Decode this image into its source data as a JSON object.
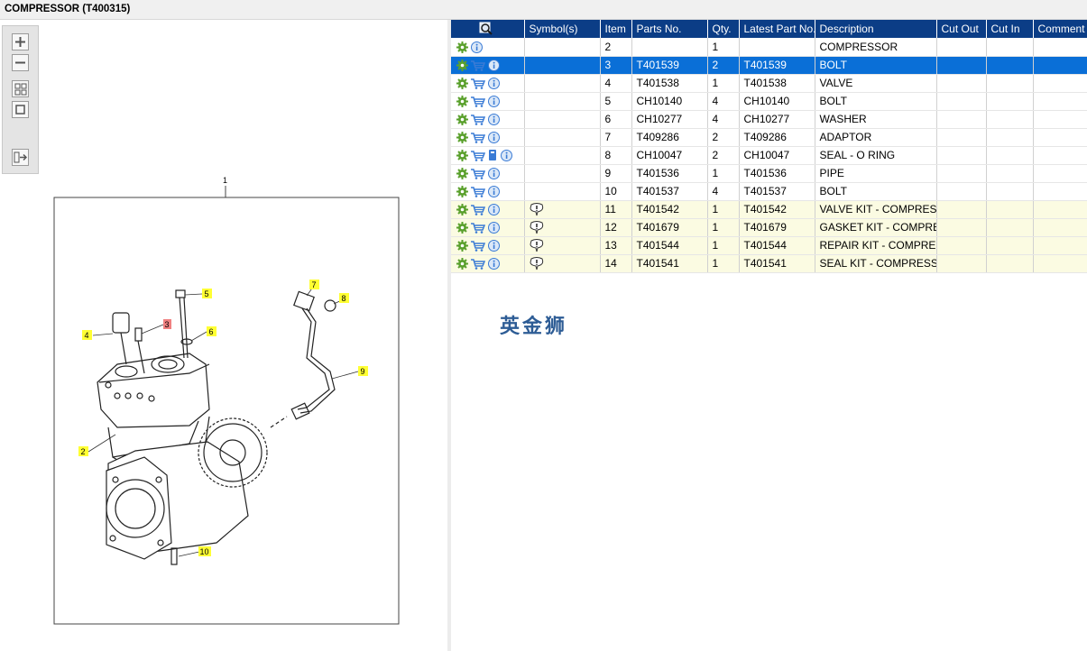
{
  "title": "COMPRESSOR (T400315)",
  "toolbar": {
    "buttons": [
      "zoom-in",
      "zoom-out",
      "fit-all",
      "fit-window",
      "export"
    ]
  },
  "diagram": {
    "assembly_number": "1",
    "callouts": [
      "2",
      "3",
      "4",
      "5",
      "6",
      "7",
      "8",
      "9",
      "10"
    ],
    "highlighted_callout": "3"
  },
  "table": {
    "headers": {
      "icons_header_icon": "search-icon",
      "symbols": "Symbol(s)",
      "item": "Item",
      "parts_no": "Parts No.",
      "qty": "Qty.",
      "latest": "Latest Part No.",
      "description": "Description",
      "cut_out": "Cut Out",
      "cut_in": "Cut In",
      "comment": "Comment"
    },
    "rows": [
      {
        "item": "2",
        "parts_no": "",
        "qty": "1",
        "latest": "",
        "description": "COMPRESSOR",
        "cut_out": "",
        "cut_in": "",
        "comment": "",
        "cart": false,
        "book": false,
        "symbol": false,
        "selected": false,
        "yellow": false
      },
      {
        "item": "3",
        "parts_no": "T401539",
        "qty": "2",
        "latest": "T401539",
        "description": "BOLT",
        "cut_out": "",
        "cut_in": "",
        "comment": "",
        "cart": true,
        "book": false,
        "symbol": false,
        "selected": true,
        "yellow": false
      },
      {
        "item": "4",
        "parts_no": "T401538",
        "qty": "1",
        "latest": "T401538",
        "description": "VALVE",
        "cut_out": "",
        "cut_in": "",
        "comment": "",
        "cart": true,
        "book": false,
        "symbol": false,
        "selected": false,
        "yellow": false
      },
      {
        "item": "5",
        "parts_no": "CH10140",
        "qty": "4",
        "latest": "CH10140",
        "description": "BOLT",
        "cut_out": "",
        "cut_in": "",
        "comment": "",
        "cart": true,
        "book": false,
        "symbol": false,
        "selected": false,
        "yellow": false
      },
      {
        "item": "6",
        "parts_no": "CH10277",
        "qty": "4",
        "latest": "CH10277",
        "description": "WASHER",
        "cut_out": "",
        "cut_in": "",
        "comment": "",
        "cart": true,
        "book": false,
        "symbol": false,
        "selected": false,
        "yellow": false
      },
      {
        "item": "7",
        "parts_no": "T409286",
        "qty": "2",
        "latest": "T409286",
        "description": "ADAPTOR",
        "cut_out": "",
        "cut_in": "",
        "comment": "",
        "cart": true,
        "book": false,
        "symbol": false,
        "selected": false,
        "yellow": false
      },
      {
        "item": "8",
        "parts_no": "CH10047",
        "qty": "2",
        "latest": "CH10047",
        "description": "SEAL - O RING",
        "cut_out": "",
        "cut_in": "",
        "comment": "",
        "cart": true,
        "book": true,
        "symbol": false,
        "selected": false,
        "yellow": false
      },
      {
        "item": "9",
        "parts_no": "T401536",
        "qty": "1",
        "latest": "T401536",
        "description": "PIPE",
        "cut_out": "",
        "cut_in": "",
        "comment": "",
        "cart": true,
        "book": false,
        "symbol": false,
        "selected": false,
        "yellow": false
      },
      {
        "item": "10",
        "parts_no": "T401537",
        "qty": "4",
        "latest": "T401537",
        "description": "BOLT",
        "cut_out": "",
        "cut_in": "",
        "comment": "",
        "cart": true,
        "book": false,
        "symbol": false,
        "selected": false,
        "yellow": false
      },
      {
        "item": "11",
        "parts_no": "T401542",
        "qty": "1",
        "latest": "T401542",
        "description": "VALVE KIT - COMPRESSOR",
        "cut_out": "",
        "cut_in": "",
        "comment": "",
        "cart": true,
        "book": false,
        "symbol": true,
        "selected": false,
        "yellow": true
      },
      {
        "item": "12",
        "parts_no": "T401679",
        "qty": "1",
        "latest": "T401679",
        "description": "GASKET KIT - COMPRESSOR",
        "cut_out": "",
        "cut_in": "",
        "comment": "",
        "cart": true,
        "book": false,
        "symbol": true,
        "selected": false,
        "yellow": true
      },
      {
        "item": "13",
        "parts_no": "T401544",
        "qty": "1",
        "latest": "T401544",
        "description": "REPAIR KIT - COMPRESSOR",
        "cut_out": "",
        "cut_in": "",
        "comment": "",
        "cart": true,
        "book": false,
        "symbol": true,
        "selected": false,
        "yellow": true
      },
      {
        "item": "14",
        "parts_no": "T401541",
        "qty": "1",
        "latest": "T401541",
        "description": "SEAL KIT - COMPRESSOR",
        "cut_out": "",
        "cut_in": "",
        "comment": "",
        "cart": true,
        "book": false,
        "symbol": true,
        "selected": false,
        "yellow": true
      }
    ]
  },
  "watermark": "英金狮",
  "colors": {
    "header_bg": "#0b3d86",
    "selected_row": "#0a6fd7",
    "kit_row": "#fbfbe2",
    "gear_icon": "#5aa02c",
    "info_icon": "#3a7bd5",
    "callout_bg": "#ffff33",
    "callout_highlight": "#f08080"
  }
}
